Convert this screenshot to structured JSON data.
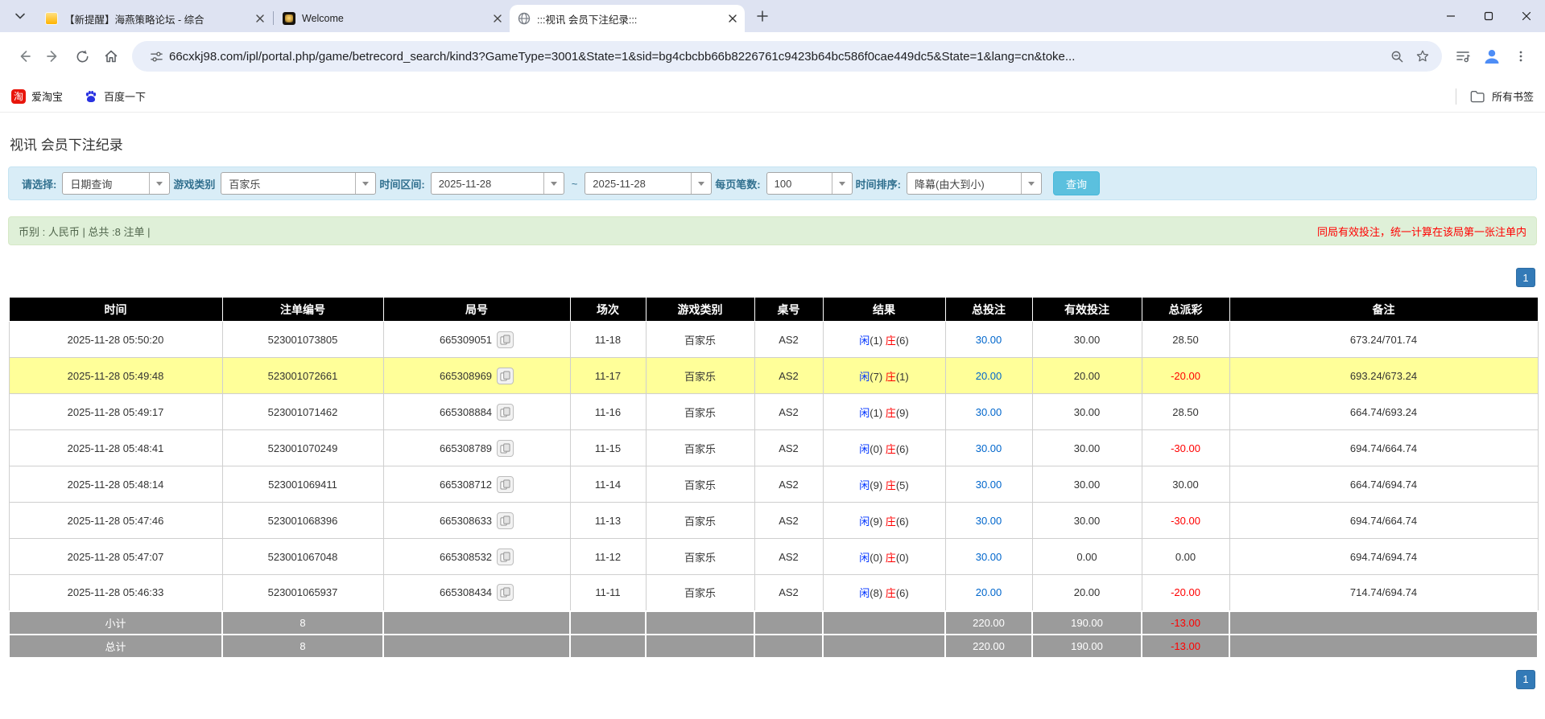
{
  "browser": {
    "tabs": [
      {
        "title": "【新提醒】海燕策略论坛 - 综合",
        "favicon": "forum-yellow-icon",
        "active": false
      },
      {
        "title": "Welcome",
        "favicon": "dark-gold-icon",
        "active": false
      },
      {
        "title": ":::视讯 会员下注纪录:::",
        "favicon": "globe-icon",
        "active": true
      }
    ],
    "url": "66cxkj98.com/ipl/portal.php/game/betrecord_search/kind3?GameType=3001&State=1&sid=bg4cbcbb66b8226761c9423b64bc586f0cae449dc5&State=1&lang=cn&toke...",
    "bookmarks": {
      "taobao": "爱淘宝",
      "baidu": "百度一下",
      "all_bookmarks": "所有书签"
    }
  },
  "page": {
    "title": "视讯 会员下注纪录",
    "filters": {
      "select_label": "请选择:",
      "select_value": "日期查询",
      "game_label": "游戏类别",
      "game_value": "百家乐",
      "range_label": "时间区间:",
      "date_from": "2025-11-28",
      "tilde": "~",
      "date_to": "2025-11-28",
      "per_page_label": "每页笔数:",
      "per_page_value": "100",
      "sort_label": "时间排序:",
      "sort_value": "降幕(由大到小)",
      "search_button": "查询"
    },
    "summary": {
      "left": "币别 : 人民币 | 总共 :8 注单 |",
      "right": "同局有效投注，统一计算在该局第一张注单内"
    },
    "pagination": "1"
  },
  "table": {
    "headers": [
      "时间",
      "注单编号",
      "局号",
      "场次",
      "游戏类别",
      "桌号",
      "结果",
      "总投注",
      "有效投注",
      "总派彩",
      "备注"
    ],
    "rows": [
      {
        "time": "2025-11-28 05:50:20",
        "bet_id": "523001073805",
        "round": "665309051",
        "session": "11-18",
        "game": "百家乐",
        "table_no": "AS2",
        "result": {
          "player": "闲",
          "player_n": "(1)",
          "banker": "庄",
          "banker_n": "(6)"
        },
        "total_bet": "30.00",
        "valid_bet": "30.00",
        "payout": "28.50",
        "note": "673.24/701.74",
        "highlight": false
      },
      {
        "time": "2025-11-28 05:49:48",
        "bet_id": "523001072661",
        "round": "665308969",
        "session": "11-17",
        "game": "百家乐",
        "table_no": "AS2",
        "result": {
          "player": "闲",
          "player_n": "(7)",
          "banker": "庄",
          "banker_n": "(1)"
        },
        "total_bet": "20.00",
        "valid_bet": "20.00",
        "payout": "-20.00",
        "note": "693.24/673.24",
        "highlight": true
      },
      {
        "time": "2025-11-28 05:49:17",
        "bet_id": "523001071462",
        "round": "665308884",
        "session": "11-16",
        "game": "百家乐",
        "table_no": "AS2",
        "result": {
          "player": "闲",
          "player_n": "(1)",
          "banker": "庄",
          "banker_n": "(9)"
        },
        "total_bet": "30.00",
        "valid_bet": "30.00",
        "payout": "28.50",
        "note": "664.74/693.24",
        "highlight": false
      },
      {
        "time": "2025-11-28 05:48:41",
        "bet_id": "523001070249",
        "round": "665308789",
        "session": "11-15",
        "game": "百家乐",
        "table_no": "AS2",
        "result": {
          "player": "闲",
          "player_n": "(0)",
          "banker": "庄",
          "banker_n": "(6)"
        },
        "total_bet": "30.00",
        "valid_bet": "30.00",
        "payout": "-30.00",
        "note": "694.74/664.74",
        "highlight": false
      },
      {
        "time": "2025-11-28 05:48:14",
        "bet_id": "523001069411",
        "round": "665308712",
        "session": "11-14",
        "game": "百家乐",
        "table_no": "AS2",
        "result": {
          "player": "闲",
          "player_n": "(9)",
          "banker": "庄",
          "banker_n": "(5)"
        },
        "total_bet": "30.00",
        "valid_bet": "30.00",
        "payout": "30.00",
        "note": "664.74/694.74",
        "highlight": false
      },
      {
        "time": "2025-11-28 05:47:46",
        "bet_id": "523001068396",
        "round": "665308633",
        "session": "11-13",
        "game": "百家乐",
        "table_no": "AS2",
        "result": {
          "player": "闲",
          "player_n": "(9)",
          "banker": "庄",
          "banker_n": "(6)"
        },
        "total_bet": "30.00",
        "valid_bet": "30.00",
        "payout": "-30.00",
        "note": "694.74/664.74",
        "highlight": false
      },
      {
        "time": "2025-11-28 05:47:07",
        "bet_id": "523001067048",
        "round": "665308532",
        "session": "11-12",
        "game": "百家乐",
        "table_no": "AS2",
        "result": {
          "player": "闲",
          "player_n": "(0)",
          "banker": "庄",
          "banker_n": "(0)"
        },
        "total_bet": "30.00",
        "valid_bet": "0.00",
        "payout": "0.00",
        "note": "694.74/694.74",
        "highlight": false
      },
      {
        "time": "2025-11-28 05:46:33",
        "bet_id": "523001065937",
        "round": "665308434",
        "session": "11-11",
        "game": "百家乐",
        "table_no": "AS2",
        "result": {
          "player": "闲",
          "player_n": "(8)",
          "banker": "庄",
          "banker_n": "(6)"
        },
        "total_bet": "20.00",
        "valid_bet": "20.00",
        "payout": "-20.00",
        "note": "714.74/694.74",
        "highlight": false
      }
    ],
    "subtotal": {
      "label": "小计",
      "count": "8",
      "total_bet": "220.00",
      "valid_bet": "190.00",
      "payout": "-13.00"
    },
    "total": {
      "label": "总计",
      "count": "8",
      "total_bet": "220.00",
      "valid_bet": "190.00",
      "payout": "-13.00"
    }
  },
  "colors": {
    "tabstrip_bg": "#dee3f2",
    "omnibox_bg": "#e9eef9",
    "filter_bg": "#d9edf7",
    "filter_label": "#31708f",
    "summary_bg": "#dff0d8",
    "annotation_red": "#ff0000",
    "table_header_bg": "#000000",
    "highlight_row": "#ffff99",
    "totals_row_bg": "#9b9b9b",
    "bet_link_blue": "#0066cc",
    "player_blue": "#0033ff",
    "banker_red": "#ff0000",
    "pager_blue": "#337ab7",
    "search_btn_blue": "#5bc0de"
  }
}
